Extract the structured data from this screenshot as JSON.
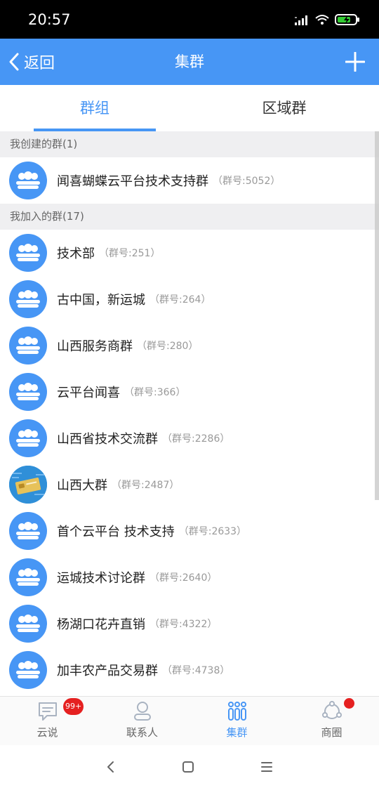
{
  "status_bar": {
    "time": "20:57"
  },
  "nav": {
    "back_label": "返回",
    "title": "集群"
  },
  "tabs": [
    {
      "label": "群组",
      "active": true
    },
    {
      "label": "区域群",
      "active": false
    }
  ],
  "sections": [
    {
      "header": "我创建的群(1)",
      "groups": [
        {
          "name": "闻喜蝴蝶云平台技术支持群",
          "id_text": "（群号:5052）"
        }
      ]
    },
    {
      "header": "我加入的群(17)",
      "groups": [
        {
          "name": "技术部",
          "id_text": "（群号:251）"
        },
        {
          "name": "古中国，新运城",
          "id_text": "（群号:264）"
        },
        {
          "name": "山西服务商群",
          "id_text": "（群号:280）"
        },
        {
          "name": "云平台闻喜",
          "id_text": "（群号:366）"
        },
        {
          "name": "山西省技术交流群",
          "id_text": "（群号:2286）"
        },
        {
          "name": "山西大群",
          "id_text": "（群号:2487）"
        },
        {
          "name": "首个云平台 技术支持",
          "id_text": "（群号:2633）"
        },
        {
          "name": "运城技术讨论群",
          "id_text": "（群号:2640）"
        },
        {
          "name": "杨湖口花卉直销",
          "id_text": "（群号:4322）"
        },
        {
          "name": "加丰农产品交易群",
          "id_text": "（群号:4738）"
        }
      ]
    }
  ],
  "tabbar": [
    {
      "label": "云说",
      "icon": "chat-icon",
      "badge": "99+"
    },
    {
      "label": "联系人",
      "icon": "contact-icon"
    },
    {
      "label": "集群",
      "icon": "cluster-icon",
      "active": true
    },
    {
      "label": "商圈",
      "icon": "business-circle-icon",
      "dot": true
    }
  ],
  "colors": {
    "primary": "#4796f5",
    "badge": "#e52020"
  }
}
